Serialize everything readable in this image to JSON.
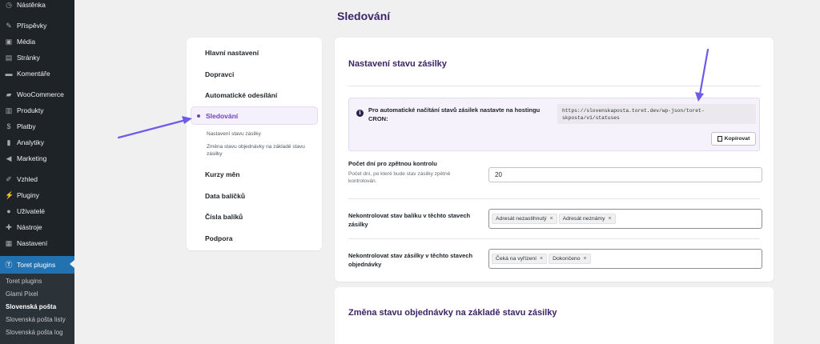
{
  "wp_menu": [
    {
      "label": "Nástěnka",
      "icon": "dashboard-icon"
    },
    {
      "label": "Příspěvky",
      "icon": "pin-icon"
    },
    {
      "label": "Média",
      "icon": "media-icon"
    },
    {
      "label": "Stránky",
      "icon": "page-icon"
    },
    {
      "label": "Komentáře",
      "icon": "comment-icon"
    },
    {
      "label": "WooCommerce",
      "icon": "woocommerce-icon"
    },
    {
      "label": "Produkty",
      "icon": "archive-icon"
    },
    {
      "label": "Platby",
      "icon": "dollar-icon"
    },
    {
      "label": "Analytiky",
      "icon": "bar-chart-icon"
    },
    {
      "label": "Marketing",
      "icon": "megaphone-icon"
    },
    {
      "label": "Vzhled",
      "icon": "paintbrush-icon"
    },
    {
      "label": "Pluginy",
      "icon": "plugin-icon"
    },
    {
      "label": "Uživatelé",
      "icon": "user-icon"
    },
    {
      "label": "Nástroje",
      "icon": "wrench-icon"
    },
    {
      "label": "Nastavení",
      "icon": "settings-icon"
    },
    {
      "label": "Toret plugins",
      "icon": "toret-icon",
      "active": true
    }
  ],
  "wp_submenu": [
    "Toret plugins",
    "Glami Pixel",
    "Slovenská pošta",
    "Slovenská pošta listy",
    "Slovenská pošta log"
  ],
  "wp_submenu_current": "Slovenská pošta",
  "page_title": "Sledování",
  "nav": {
    "items": [
      "Hlavní nastavení",
      "Dopravci",
      "Automatické odesílání",
      "Sledování",
      "Kurzy měn",
      "Data balíčků",
      "Čísla balíků",
      "Podpora"
    ],
    "active": "Sledování",
    "subitems": [
      "Nastavení stavu zásilky",
      "Změna stavu objednávky na základě stavu zásilky"
    ]
  },
  "section1": {
    "title": "Nastavení stavu zásilky",
    "notice_text": "Pro automatické načítání stavů zásilek nastavte na hostingu CRON:",
    "cron_url": "https://slovenskaposta.toret.dev/wp-json/toret-skposta/v1/statuses",
    "copy_label": "Kopírovat",
    "days_label": "Počet dní pro zpětnou kontrolu",
    "days_desc": "Počet dní, po které bude stav zásilky zpětně kontrolován.",
    "days_value": "20",
    "pkg_label": "Nekontrolovat stav balíku v těchto stavech zásilky",
    "pkg_tags": [
      "Adresát nezastihnutý",
      "Adresát neznámy"
    ],
    "order_label": "Nekontrolovat stav zásilky v těchto stavech objednávky",
    "order_tags": [
      "Čeká na vyřízení",
      "Dokončeno"
    ]
  },
  "section2": {
    "title": "Změna stavu objednávky na základě stavu zásilky"
  },
  "colors": {
    "sidebar": "#1d2327",
    "accent": "#6f42c1",
    "heading": "#3c2468",
    "arrow": "#6c5ce7"
  }
}
